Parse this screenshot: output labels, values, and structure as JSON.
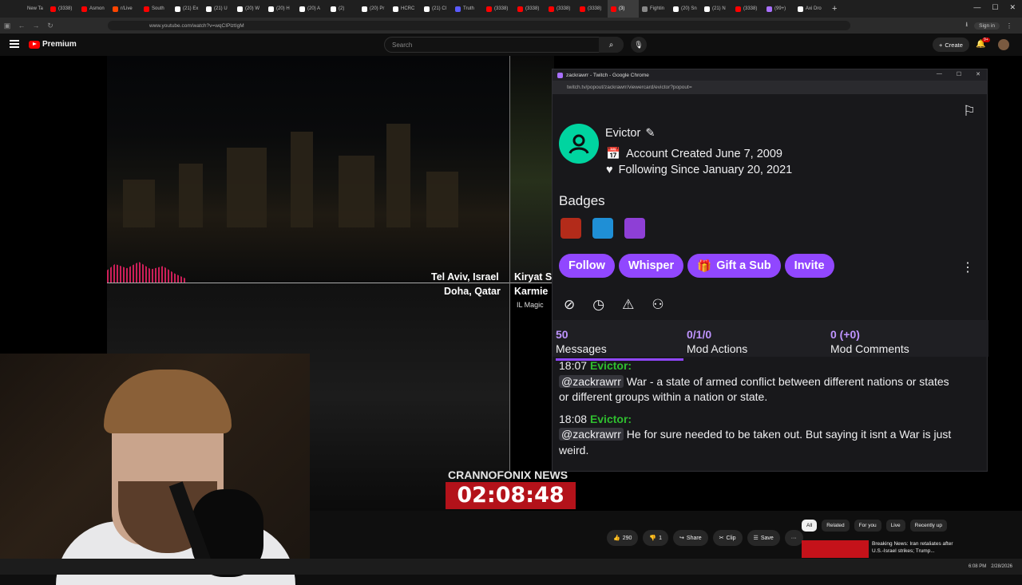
{
  "browser": {
    "tabs": [
      {
        "label": "New Ta",
        "color": "#888"
      },
      {
        "label": "(3338)",
        "color": "#f00"
      },
      {
        "label": "Asmon",
        "color": "#f00"
      },
      {
        "label": "r/Live",
        "color": "#ff4500"
      },
      {
        "label": "South",
        "color": "#f00"
      },
      {
        "label": "(21) Ex",
        "color": "#fff"
      },
      {
        "label": "(21) U",
        "color": "#fff"
      },
      {
        "label": "(20) W",
        "color": "#fff"
      },
      {
        "label": "(20) H",
        "color": "#fff"
      },
      {
        "label": "(20) A",
        "color": "#fff"
      },
      {
        "label": "(2)",
        "color": "#fff"
      },
      {
        "label": "(20) Pr",
        "color": "#fff"
      },
      {
        "label": "HCRC",
        "color": "#fff"
      },
      {
        "label": "(21) Cl",
        "color": "#fff"
      },
      {
        "label": "Truth",
        "color": "#5b5bff"
      },
      {
        "label": "(3338)",
        "color": "#f00"
      },
      {
        "label": "(3338)",
        "color": "#f00"
      },
      {
        "label": "(3338)",
        "color": "#f00"
      },
      {
        "label": "(3338)",
        "color": "#f00"
      },
      {
        "label": "(3)",
        "color": "#f00"
      },
      {
        "label": "Fightin",
        "color": "#888"
      },
      {
        "label": "(20) Sn",
        "color": "#fff"
      },
      {
        "label": "(21) N",
        "color": "#fff"
      },
      {
        "label": "(3338)",
        "color": "#f00"
      },
      {
        "label": "(99+)",
        "color": "#a970ff"
      },
      {
        "label": "Axi Dro",
        "color": "#fff"
      }
    ],
    "url": "www.youtube.com/watch?v=wqCIPlztIgM",
    "sign_in": "Sign in"
  },
  "youtube": {
    "brand": "Premium",
    "search_placeholder": "Search",
    "create_label": "Create",
    "notif_count": "9+",
    "actions": [
      {
        "icon": "like-icon",
        "label": "290"
      },
      {
        "icon": "dislike-icon",
        "label": "1"
      },
      {
        "icon": "share-icon",
        "label": "Share"
      },
      {
        "icon": "clip-icon",
        "label": "Clip"
      },
      {
        "icon": "save-icon",
        "label": "Save"
      },
      {
        "icon": "more-icon",
        "label": "···"
      }
    ],
    "chips": [
      "All",
      "Related",
      "For you",
      "Live",
      "Recently up"
    ],
    "rec_title": "Breaking News: Iran retaliates after U.S.-Israel strikes; Trump..."
  },
  "video": {
    "loc_left_1": "Tel Aviv, Israel",
    "loc_left_2": "Doha, Qatar",
    "loc_right_1": "Kiryat S",
    "loc_right_2": "Karmie",
    "loc_right_3": "IL Magic",
    "news_label": "CRANNOFONIX NEWS",
    "timer": "02:08:48"
  },
  "popup": {
    "window_title": "zackrawrr - Twitch - Google Chrome",
    "url": "twitch.tv/popout/zackrawrr/viewercard/evictor?popout=",
    "username": "Evictor",
    "account_created": "Account Created June 7, 2009",
    "following_since": "Following Since January 20, 2021",
    "badges_heading": "Badges",
    "badge_colors": [
      "#b32b1a",
      "#1f8fd6",
      "#8e3fd6"
    ],
    "buttons": {
      "follow": "Follow",
      "whisper": "Whisper",
      "gift": "Gift a Sub",
      "invite": "Invite"
    },
    "stats": [
      {
        "value": "50",
        "label": "Messages"
      },
      {
        "value": "0/1/0",
        "label": "Mod Actions"
      },
      {
        "value": "0 (+0)",
        "label": "Mod Comments"
      }
    ],
    "chat": [
      {
        "time": "18:07",
        "user": "Evictor:",
        "mention": "@zackrawrr",
        "text": "War - a state of armed conflict between different nations or states or different groups within a nation or state."
      },
      {
        "time": "18:08",
        "user": "Evictor:",
        "mention": "@zackrawrr",
        "text": "He for sure needed to be taken out. But saying it isnt a War is just weird."
      }
    ]
  },
  "taskbar": {
    "time": "6:08 PM",
    "date": "2/28/2026"
  }
}
